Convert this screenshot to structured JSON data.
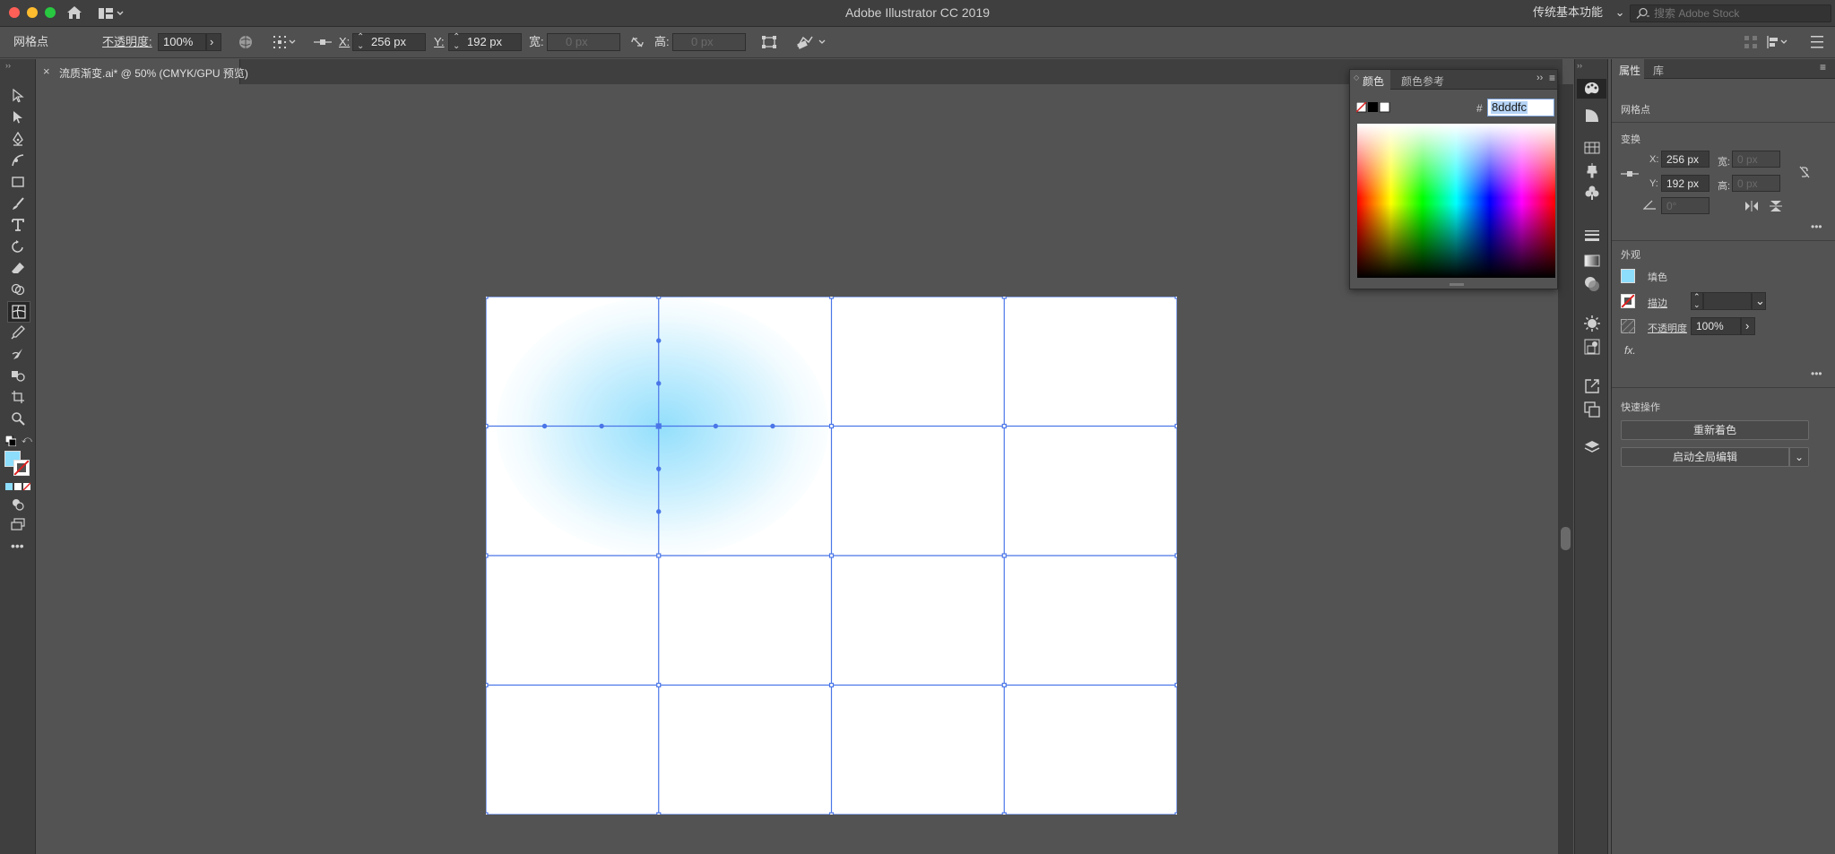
{
  "app": {
    "title": "Adobe Illustrator CC 2019",
    "workspace": "传统基本功能",
    "stock_search_placeholder": "搜索 Adobe Stock"
  },
  "colors": {
    "fill": "#8dddfc",
    "accent": "#4a76e8",
    "titlebar": "#3f3f3f"
  },
  "control_bar": {
    "selection_label": "网格点",
    "opacity_label": "不透明度:",
    "opacity_value": "100%",
    "x_label": "X:",
    "x_value": "256 px",
    "y_label": "Y:",
    "y_value": "192 px",
    "w_label": "宽:",
    "w_value": "0 px",
    "h_label": "高:",
    "h_value": "0 px"
  },
  "document_tab": {
    "close": "×",
    "title": "流质渐变.ai* @ 50% (CMYK/GPU 预览)"
  },
  "color_panel": {
    "tab_color": "颜色",
    "tab_color_guide": "颜色参考",
    "hash_label": "#",
    "hex_value": "8dddfc"
  },
  "properties_panel": {
    "tab_properties": "属性",
    "tab_library": "库",
    "object_type": "网格点",
    "transform_title": "变换",
    "x_label": "X:",
    "x_value": "256 px",
    "y_label": "Y:",
    "y_value": "192 px",
    "w_label": "宽:",
    "w_value": "0 px",
    "h_label": "高:",
    "h_value": "0 px",
    "angle_value": "0°",
    "appearance_title": "外观",
    "fill_label": "填色",
    "stroke_label": "描边",
    "opacity_label": "不透明度",
    "opacity_value": "100%",
    "fx_label": "fx.",
    "quick_actions_title": "快速操作",
    "recolor_button": "重新着色",
    "global_edit_button": "启动全局编辑"
  },
  "mesh": {
    "rows": 4,
    "cols": 4,
    "selected_point": [
      1,
      1
    ]
  }
}
